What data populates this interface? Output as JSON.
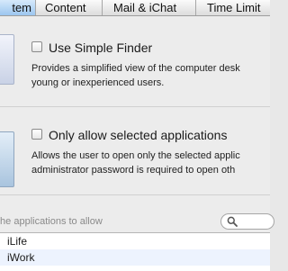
{
  "tabs": [
    {
      "label": "tem"
    },
    {
      "label": "Content"
    },
    {
      "label": "Mail & iChat"
    },
    {
      "label": "Time Limit"
    }
  ],
  "options": {
    "simple_finder": {
      "label": "Use Simple Finder",
      "description_line1": "Provides a simplified view of the computer desk",
      "description_line2": "young or inexperienced users.",
      "checked": false
    },
    "allow_selected_apps": {
      "label": "Only allow selected applications",
      "description_line1": "Allows the user to open only the selected applic",
      "description_line2": "administrator password is required to open oth",
      "checked": false
    }
  },
  "apps_filter": {
    "label": "the applications to allow",
    "search_placeholder": "",
    "search_icon": "search-icon"
  },
  "app_list": [
    {
      "label": "iLife"
    },
    {
      "label": "iWork"
    }
  ],
  "colors": {
    "selected_tab": "#9cc6ef",
    "list_alt_row": "#edf3fe"
  }
}
